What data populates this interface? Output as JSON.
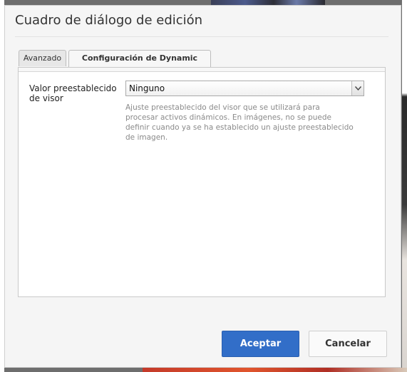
{
  "dialog": {
    "title": "Cuadro de diálogo de edición"
  },
  "tabs": [
    {
      "label": "Avanzado",
      "active": false
    },
    {
      "label": "Configuración de Dynamic Media",
      "active": true
    }
  ],
  "form": {
    "viewer_preset": {
      "label": "Valor preestablecido de visor",
      "selected_value": "Ninguno",
      "help_text": "Ajuste preestablecido del visor que se utilizará para procesar activos dinámicos. En imágenes, no se puede definir cuando ya se ha establecido un ajuste preestablecido de imagen."
    }
  },
  "buttons": {
    "accept": "Aceptar",
    "cancel": "Cancelar"
  },
  "colors": {
    "accent": "#326ec8"
  },
  "icons": {
    "dropdown": "chevron-down-icon"
  }
}
